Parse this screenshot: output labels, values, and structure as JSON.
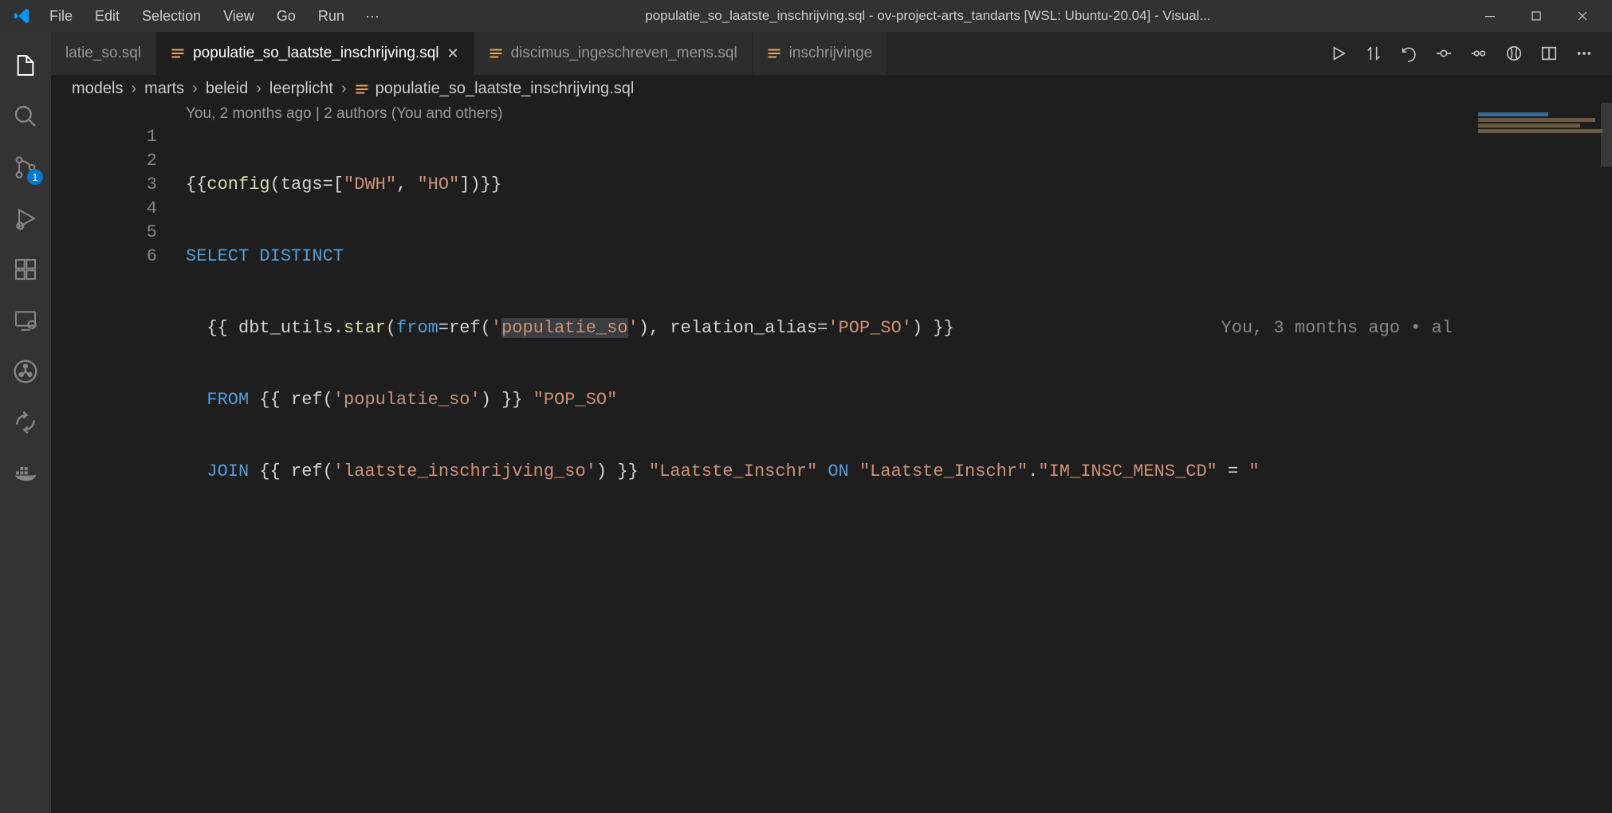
{
  "menu": {
    "file": "File",
    "edit": "Edit",
    "selection": "Selection",
    "view": "View",
    "go": "Go",
    "run": "Run",
    "more": "···"
  },
  "title": "populatie_so_laatste_inschrijving.sql - ov-project-arts_tandarts [WSL: Ubuntu-20.04] - Visual...",
  "activitybar": {
    "scm_badge": "1"
  },
  "tabs": {
    "t0": "latie_so.sql",
    "t1": "populatie_so_laatste_inschrijving.sql",
    "t2": "discimus_ingeschreven_mens.sql",
    "t3": "inschrijvinge"
  },
  "breadcrumbs": {
    "b0": "models",
    "b1": "marts",
    "b2": "beleid",
    "b3": "leerplicht",
    "b4": "populatie_so_laatste_inschrijving.sql"
  },
  "codelens": "You, 2 months ago | 2 authors (You and others)",
  "gutter": {
    "l1": "1",
    "l2": "2",
    "l3": "3",
    "l4": "4",
    "l5": "5",
    "l6": "6"
  },
  "code": {
    "l1": {
      "p1": "{{",
      "fn": "config",
      "p2": "(tags=[",
      "s1": "\"DWH\"",
      "p3": ", ",
      "s2": "\"HO\"",
      "p4": "])}}"
    },
    "l2": {
      "k1": "SELECT",
      "k2": " DISTINCT"
    },
    "l3": {
      "p1": "  {{ dbt_utils.",
      "fn": "star",
      "p2": "(",
      "kw": "from",
      "p3": "=ref(",
      "s1a": "'",
      "s1b": "populatie_so",
      "s1c": "'",
      "p4": "), relation_alias=",
      "s2": "'POP_SO'",
      "p5": ") }}",
      "blame": "You, 3 months ago • al"
    },
    "l4": {
      "k1": "FROM",
      "p1": " {{ ref(",
      "s1": "'populatie_so'",
      "p2": ") }} ",
      "s2": "\"POP_SO\""
    },
    "l5": {
      "k1": "JOIN",
      "p1": " {{ ref(",
      "s1": "'laatste_inschrijving_so'",
      "p2": ") }} ",
      "s2": "\"Laatste_Inschr\"",
      "sp": " ",
      "k2": "ON",
      "sp2": " ",
      "s3": "\"Laatste_Inschr\"",
      "p3": ".",
      "s4": "\"IM_INSC_MENS_CD\"",
      "p4": " = ",
      "s5": "\""
    }
  }
}
